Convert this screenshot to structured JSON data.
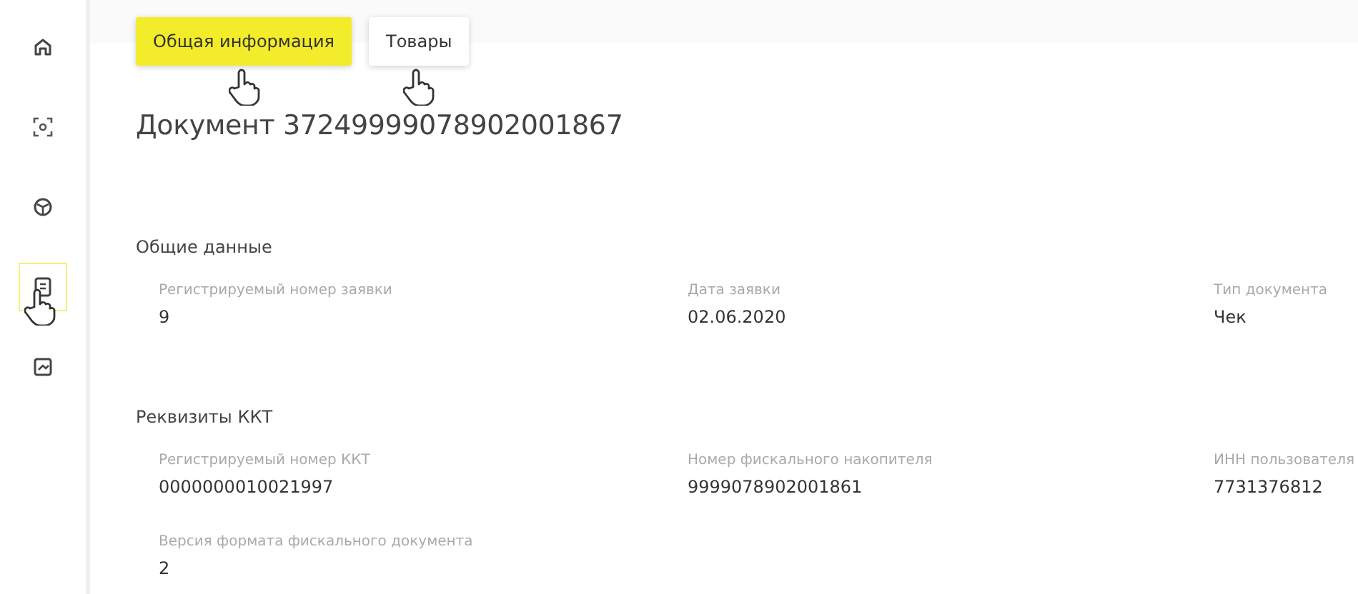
{
  "sidebar": {
    "items": [
      {
        "kind": "home",
        "selected": false,
        "hover": false
      },
      {
        "kind": "scan",
        "selected": false,
        "hover": false
      },
      {
        "kind": "box",
        "selected": false,
        "hover": false
      },
      {
        "kind": "document",
        "selected": true,
        "hover": true
      },
      {
        "kind": "chart",
        "selected": false,
        "hover": false
      }
    ]
  },
  "tabs": [
    {
      "label": "Общая информация",
      "selected": true,
      "hover": true
    },
    {
      "label": "Товары",
      "selected": false,
      "hover": true
    }
  ],
  "title": "Документ 37249999078902001867",
  "sections": [
    {
      "title": "Общие данные",
      "fields": [
        {
          "label": "Регистрируемый номер заявки",
          "value": "9"
        },
        {
          "label": "Дата заявки",
          "value": "02.06.2020"
        },
        {
          "label": "Тип документа",
          "value": "Чек"
        }
      ]
    },
    {
      "title": "Реквизиты ККТ",
      "fields": [
        {
          "label": "Регистрируемый номер ККТ",
          "value": "0000000010021997"
        },
        {
          "label": "Номер фискального накопителя",
          "value": "9999078902001861"
        },
        {
          "label": "ИНН пользователя",
          "value": "7731376812"
        },
        {
          "label": "Версия формата фискального документа",
          "value": "2"
        }
      ]
    }
  ]
}
